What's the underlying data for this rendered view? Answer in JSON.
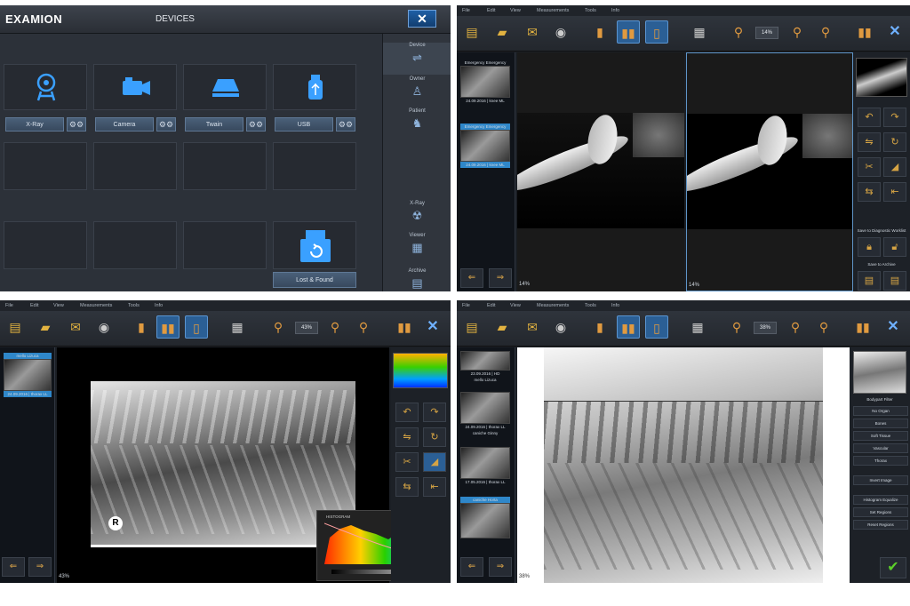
{
  "p1": {
    "logo": "EXAMION",
    "title": "DEVICES",
    "close": "✕",
    "devices": [
      {
        "label": "X-Ray",
        "icon": "xray-icon"
      },
      {
        "label": "Camera",
        "icon": "camera-icon"
      },
      {
        "label": "Twain",
        "icon": "scanner-icon"
      },
      {
        "label": "USB",
        "icon": "usb-icon"
      }
    ],
    "lost_found": "Lost & Found",
    "side": {
      "device": "Device",
      "owner": "Owner",
      "patient": "Patient",
      "xray": "X-Ray",
      "viewer": "Viewer",
      "archive": "Archive"
    }
  },
  "menu": {
    "file": "File",
    "edit": "Edit",
    "view": "View",
    "measurements": "Measurements",
    "tools": "Tools",
    "info": "Info"
  },
  "p2": {
    "zoom": "14%",
    "thumbs": [
      {
        "title": "Emergency Emergency",
        "date": "24.09.2016 | knee ML"
      },
      {
        "title": "Emergency Emergency",
        "date": "24.09.2016 | knee ML"
      }
    ],
    "save_diag": "Save to Diagnostic Worklist",
    "save_archive": "Save to Archive",
    "pct_left": "14%",
    "pct_right": "14%"
  },
  "p3": {
    "zoom": "43%",
    "thumb_title": "mello Lizuca",
    "thumb_date": "24.09.2016 | thorax LL",
    "histogram": "HISTOGRAM",
    "marker": "R",
    "pct": "43%"
  },
  "p4": {
    "zoom": "38%",
    "thumbs": [
      {
        "title": "23.09.2016 | HD",
        "sub": "mello Lizuca"
      },
      {
        "title": "24.09.2016 | thorax LL",
        "sub": "caniche Ginny"
      },
      {
        "title": "17.05.2016 | thorax LL",
        "sub": "caniche Horta"
      }
    ],
    "filter_title": "Bodypart Filter",
    "filters": [
      "No Organ",
      "Bones",
      "Soft Tissue",
      "Vascular",
      "Thorax"
    ],
    "actions": [
      "Invert Image",
      "Histogram Equalize",
      "Set Regions",
      "Reset Regions"
    ],
    "pct": "38%"
  },
  "colors": {
    "accent": "#2b5f95",
    "selection": "#2f87c9",
    "icon_blue": "#3aa0ff",
    "tool_gold": "#d6a444"
  }
}
